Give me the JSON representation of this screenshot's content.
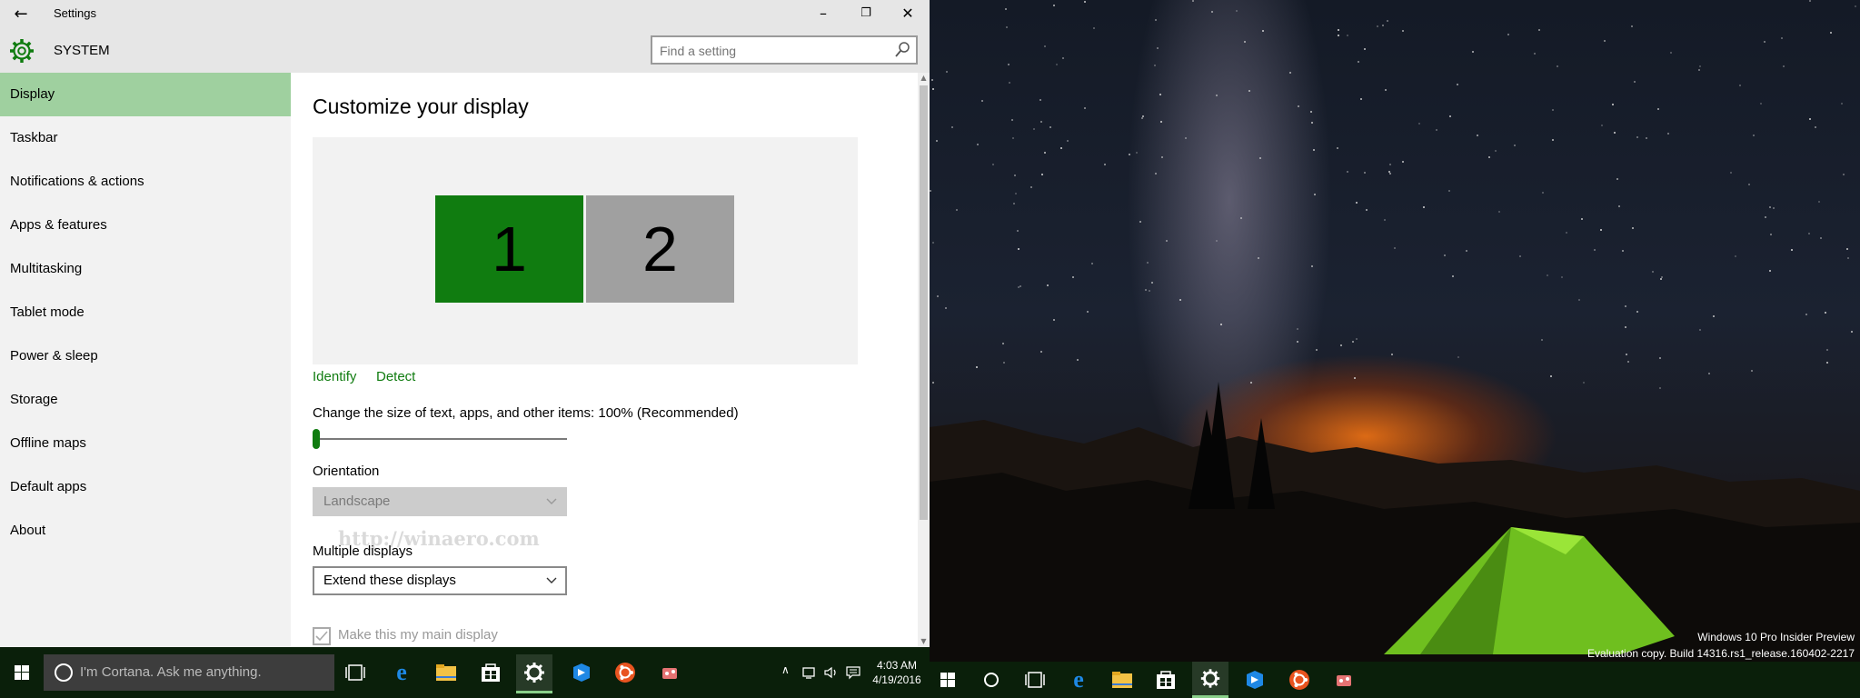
{
  "window": {
    "title": "Settings",
    "back_icon": "back-arrow-icon",
    "minimize_glyph": "–",
    "restore_glyph": "❐",
    "close_glyph": "✕"
  },
  "header": {
    "section": "SYSTEM",
    "search_placeholder": "Find a setting"
  },
  "sidebar": {
    "items": [
      {
        "label": "Display",
        "active": true
      },
      {
        "label": "Taskbar"
      },
      {
        "label": "Notifications & actions"
      },
      {
        "label": "Apps & features"
      },
      {
        "label": "Multitasking"
      },
      {
        "label": "Tablet mode"
      },
      {
        "label": "Power & sleep"
      },
      {
        "label": "Storage"
      },
      {
        "label": "Offline maps"
      },
      {
        "label": "Default apps"
      },
      {
        "label": "About"
      }
    ]
  },
  "main": {
    "title": "Customize your display",
    "monitor1": "1",
    "monitor2": "2",
    "identify": "Identify",
    "detect": "Detect",
    "scale_label": "Change the size of text, apps, and other items: 100% (Recommended)",
    "scale_value_percent": 100,
    "orientation_label": "Orientation",
    "orientation_value": "Landscape",
    "multiple_label": "Multiple displays",
    "multiple_value": "Extend these displays",
    "main_display_label": "Make this my main display",
    "watermark": "http://winaero.com"
  },
  "taskbar_left": {
    "cortana_placeholder": "I'm Cortana. Ask me anything.",
    "time": "4:03 AM",
    "date": "4/19/2016"
  },
  "desktop": {
    "eval_line1": "Windows 10 Pro Insider Preview",
    "eval_line2": "Evaluation copy. Build 14316.rs1_release.160402-2217"
  },
  "colors": {
    "accent": "#107c10",
    "sidebar_active": "#9fd09f",
    "taskbar": "#0a1f0a"
  }
}
